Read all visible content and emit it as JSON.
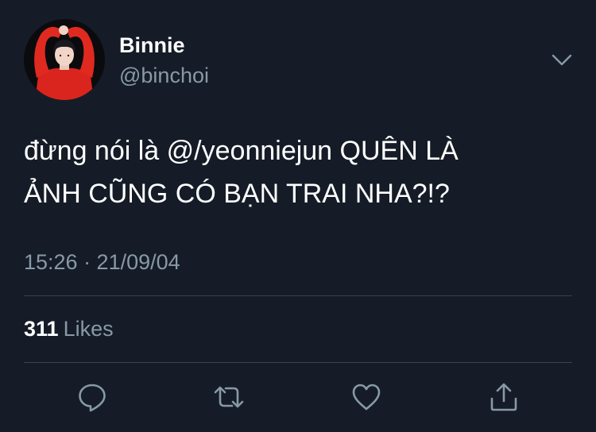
{
  "author": {
    "display_name": "Binnie",
    "handle": "@binchoi"
  },
  "tweet": {
    "text_lines": [
      "đừng nói là @/yeonniejun QUÊN LÀ",
      "ẢNH CŨNG CÓ BẠN TRAI NHA?!?"
    ],
    "timestamp": "15:26 · 21/09/04"
  },
  "stats": {
    "likes_count": "311",
    "likes_label": "Likes"
  },
  "icons": {
    "menu": "chevron-down-icon",
    "reply": "reply-icon",
    "retweet": "retweet-icon",
    "like": "heart-icon",
    "share": "share-icon"
  },
  "colors": {
    "background": "#151c27",
    "primary_text": "#ffffff",
    "secondary_text": "#8899a6",
    "divider": "#38444d"
  }
}
